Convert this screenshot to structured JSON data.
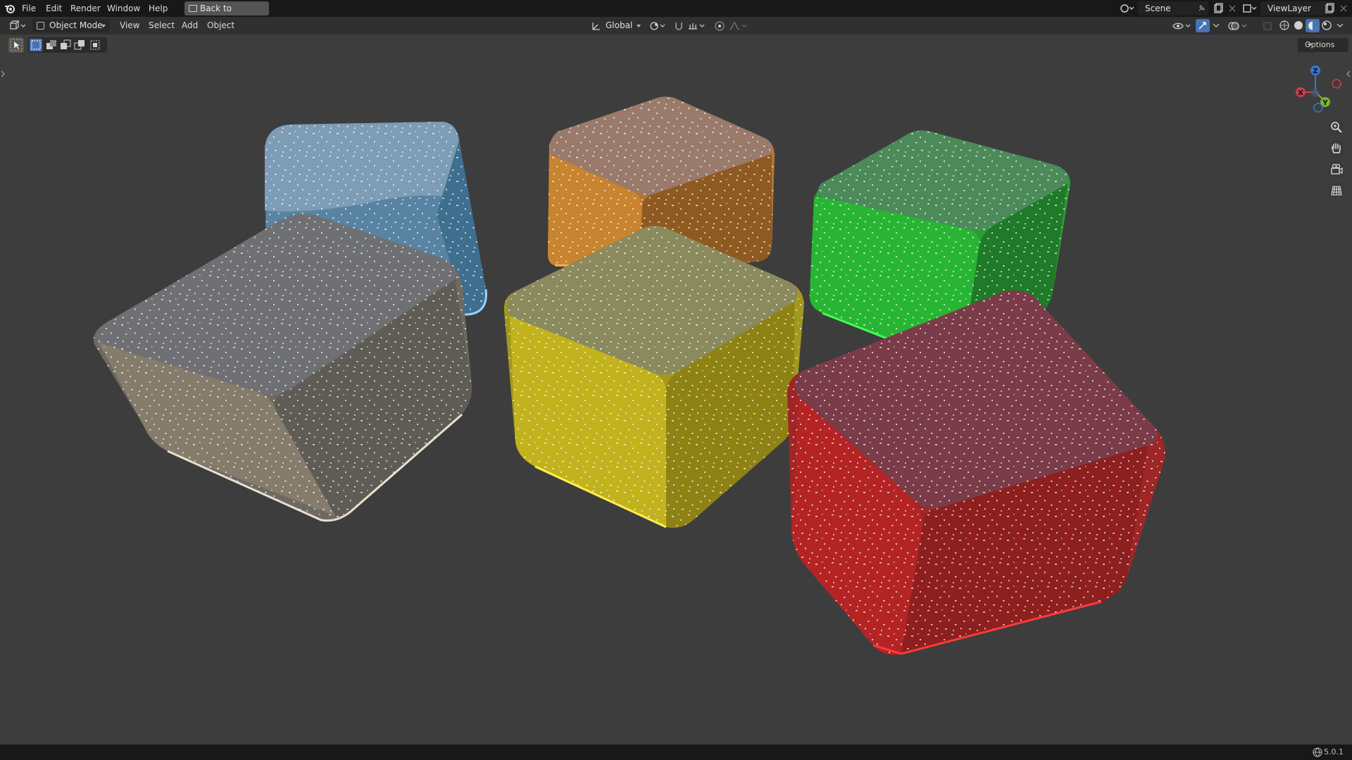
{
  "menubar": {
    "items": [
      "File",
      "Edit",
      "Render",
      "Window",
      "Help"
    ],
    "back_button": "Back to Previous",
    "scene_label": "Scene",
    "view_layer_label": "ViewLayer"
  },
  "header": {
    "mode": "Object Mode",
    "menus": [
      "View",
      "Select",
      "Add",
      "Object"
    ],
    "transform_orientation": "Global"
  },
  "viewport": {
    "options_label": "Options",
    "gizmo_axes": [
      "Z",
      "Y",
      "X"
    ],
    "objects": [
      {
        "name": "blue-jelly-cube",
        "color": "#5b87a8"
      },
      {
        "name": "orange-jelly-cube",
        "color": "#c8842f"
      },
      {
        "name": "green-jelly-cube",
        "color": "#29b534"
      },
      {
        "name": "clear-jelly-cube",
        "color": "#8a8478"
      },
      {
        "name": "yellow-jelly-cube",
        "color": "#c2b21e"
      },
      {
        "name": "red-jelly-cube",
        "color": "#b52424"
      }
    ]
  },
  "status": {
    "version": "5.0.1"
  },
  "colors": {
    "topbar": "#181818",
    "header": "#303030",
    "viewport": "#3d3d3d",
    "accent": "#4772b3"
  }
}
